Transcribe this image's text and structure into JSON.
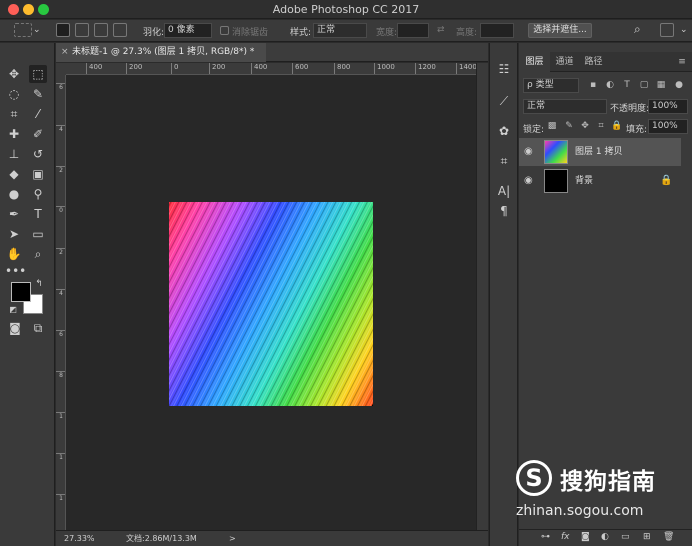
{
  "window": {
    "title": "Adobe Photoshop CC 2017"
  },
  "options_bar": {
    "feather_label": "羽化:",
    "feather_value": "0 像素",
    "anti_alias_label": "消除锯齿",
    "style_label": "样式:",
    "style_value": "正常",
    "width_label": "宽度:",
    "height_label": "高度:",
    "select_mask_label": "选择并遮住..."
  },
  "document": {
    "tab_title": "未标题-1 @ 27.3% (图层 1 拷贝, RGB/8*) *",
    "ruler_h_ticks": [
      "400",
      "200",
      "0",
      "200",
      "400",
      "600",
      "800",
      "1000",
      "1200",
      "1400"
    ],
    "ruler_v_ticks": [
      "6",
      "4",
      "2",
      "0",
      "2",
      "4",
      "6",
      "8",
      "1",
      "1",
      "1"
    ],
    "zoom": "27.33%",
    "doc_info": "文档:2.86M/13.3M",
    "status_arrow": ">"
  },
  "layers_panel": {
    "tabs": [
      "图层",
      "通道",
      "路径"
    ],
    "filter_kind": "ρ 类型",
    "blend_mode": "正常",
    "opacity_label": "不透明度:",
    "opacity_value": "100%",
    "lock_label": "锁定:",
    "fill_label": "填充:",
    "fill_value": "100%",
    "layers": [
      {
        "name": "图层 1 拷贝",
        "selected": true
      },
      {
        "name": "背景",
        "selected": false,
        "locked": true
      }
    ],
    "bottom_fx": "fx"
  },
  "watermark": {
    "name": "搜狗指南",
    "url": "zhinan.sogou.com",
    "logo_letter": "S"
  },
  "colors": {
    "accent_bg": "#2b2b2b",
    "selection": "#545454"
  }
}
